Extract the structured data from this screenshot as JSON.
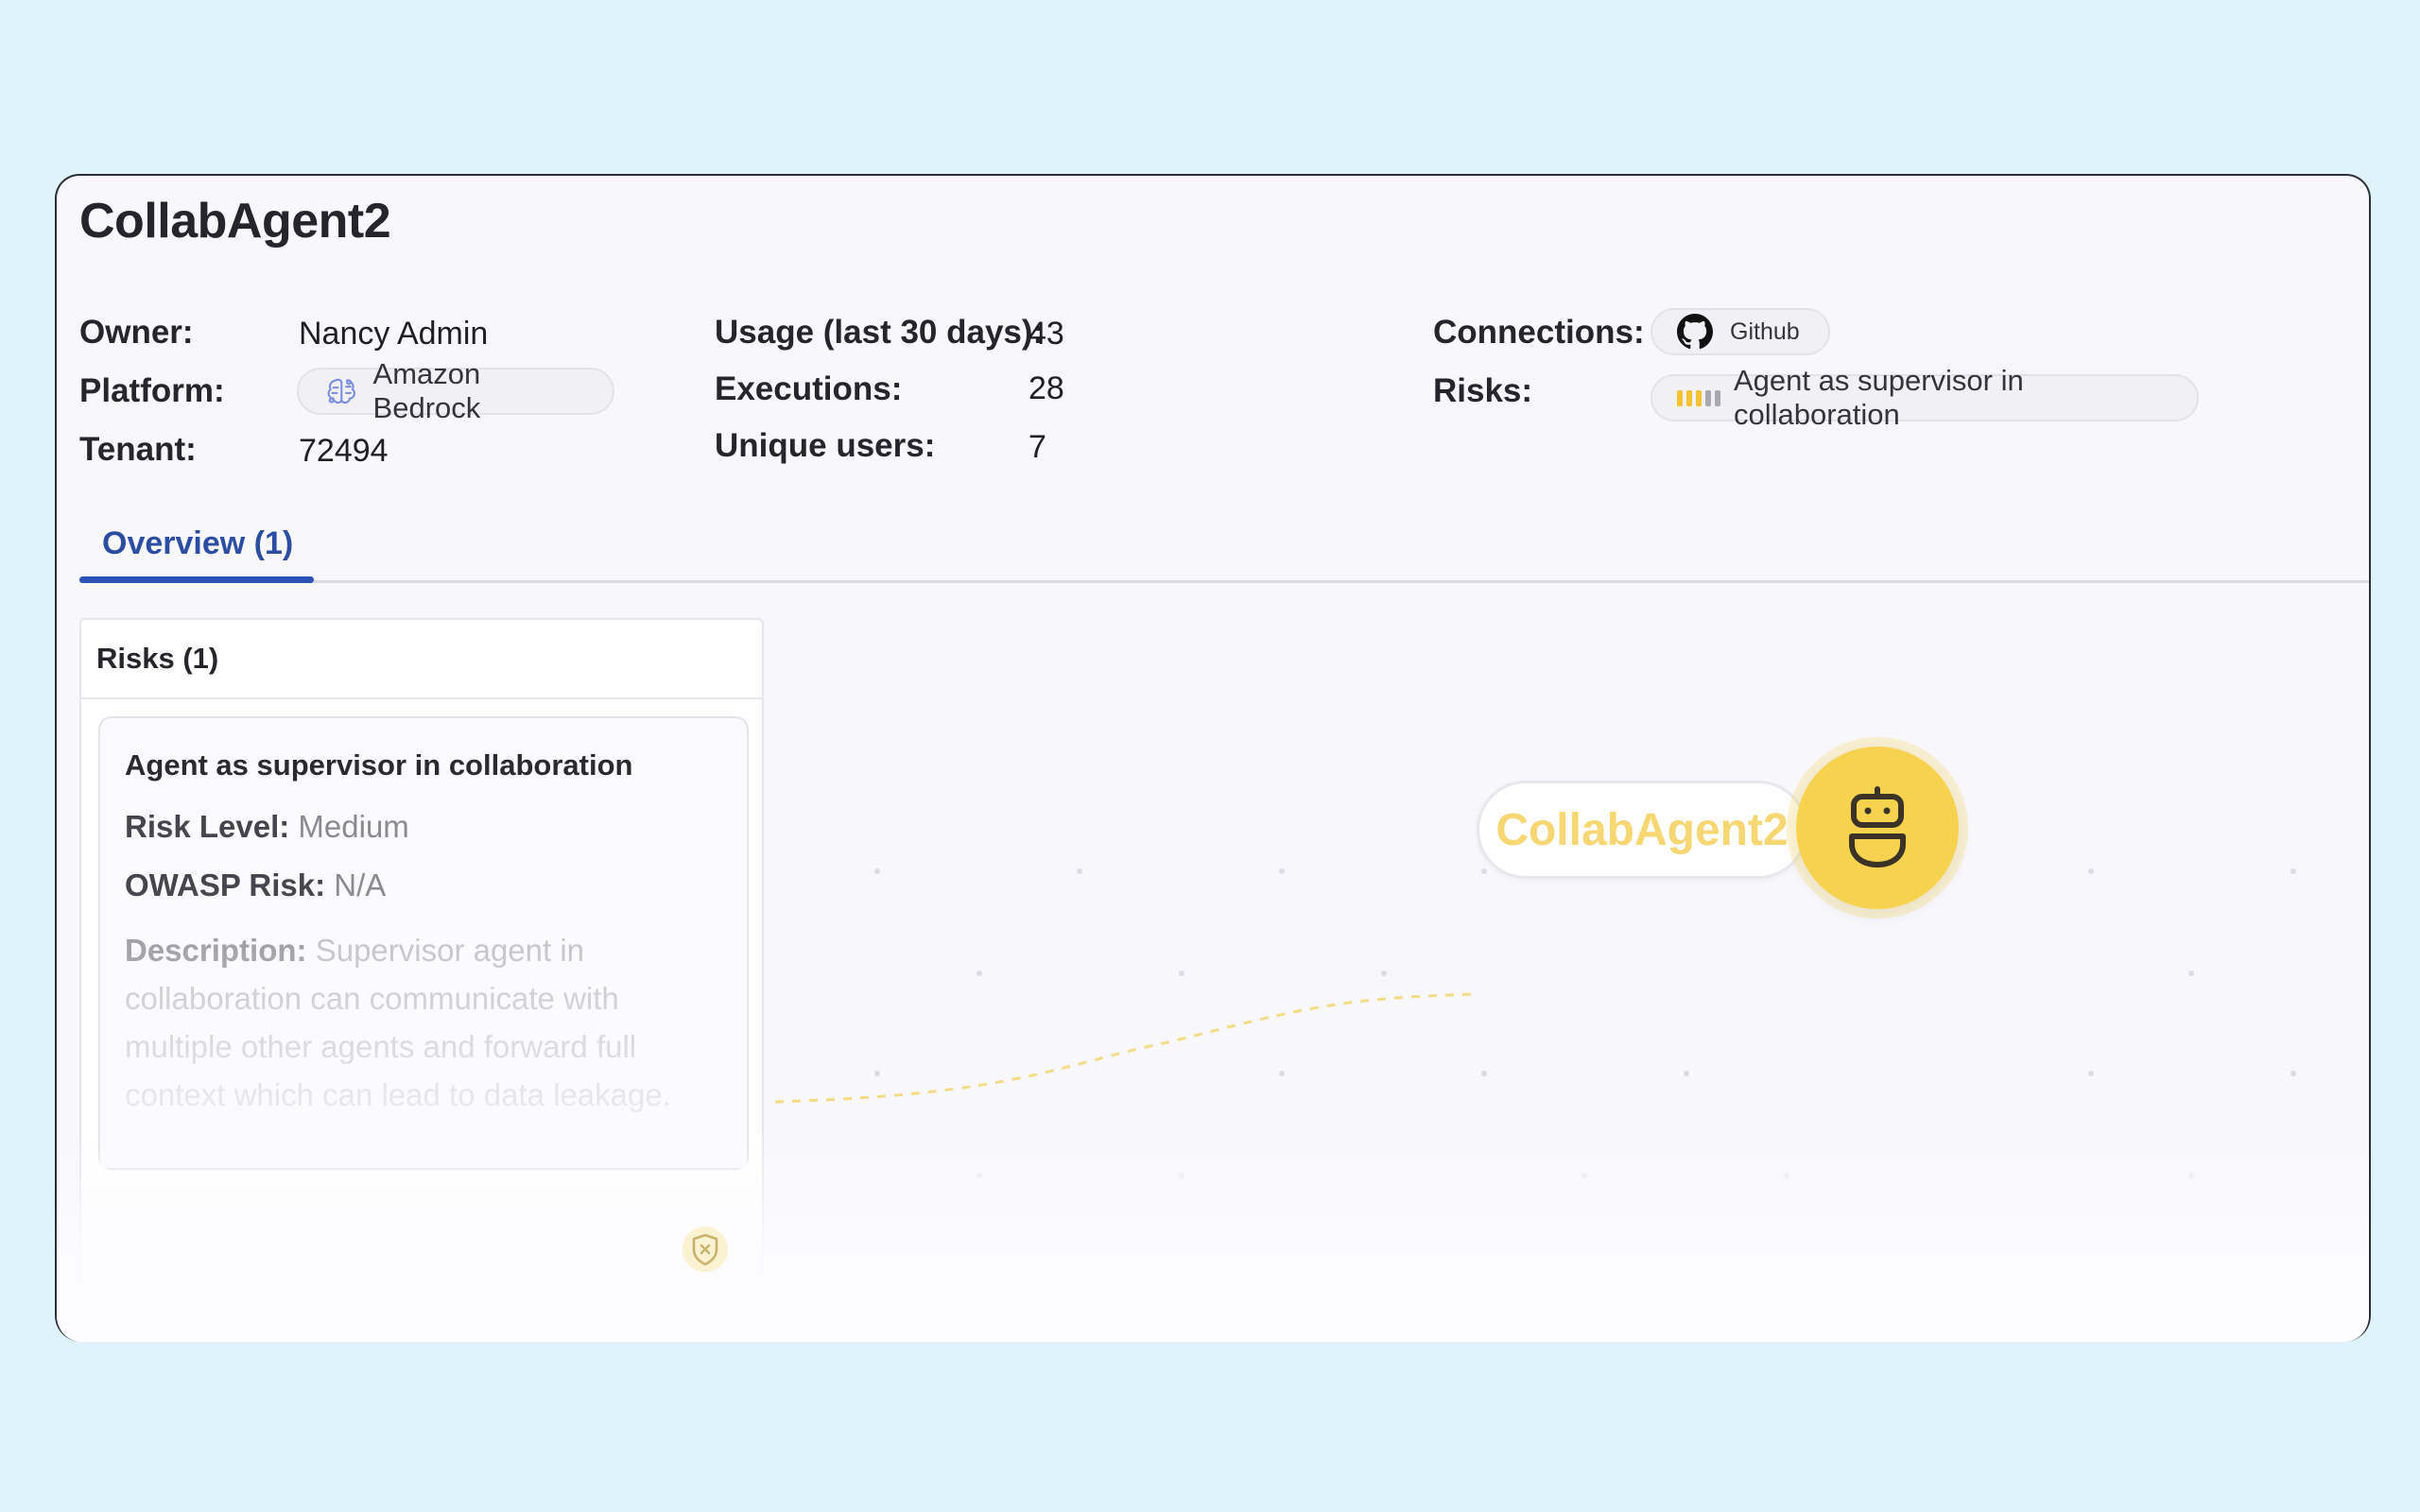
{
  "agent": {
    "name": "CollabAgent2"
  },
  "details": {
    "owner_label": "Owner:",
    "owner_value": "Nancy Admin",
    "platform_label": "Platform:",
    "platform_value": "Amazon Bedrock",
    "tenant_label": "Tenant:",
    "tenant_value": "72494"
  },
  "usage": {
    "usage_label": "Usage (last 30 days):",
    "usage_value": "43",
    "executions_label": "Executions:",
    "executions_value": "28",
    "unique_users_label": "Unique users:",
    "unique_users_value": "7"
  },
  "connections": {
    "label": "Connections:",
    "items": [
      {
        "name": "Github",
        "icon": "github-icon"
      }
    ]
  },
  "risks_summary": {
    "label": "Risks:",
    "items": [
      {
        "name": "Agent as supervisor in collaboration",
        "level_bars_filled": 3,
        "level_bars_total": 5
      }
    ]
  },
  "tabs": [
    {
      "label": "Overview (1)",
      "active": true
    }
  ],
  "risk_panel": {
    "title": "Risks (1)",
    "cards": [
      {
        "title": "Agent as supervisor in collaboration",
        "risk_level_label": "Risk Level:",
        "risk_level_value": "Medium",
        "owasp_label": "OWASP Risk:",
        "owasp_value": "N/A",
        "description_label": "Description:",
        "description_value": "Supervisor agent in collaboration can communicate with multiple other agents and forward full context which can lead to data leakage."
      }
    ]
  },
  "graph": {
    "nodes": [
      {
        "label": "CollabAgent2",
        "icon": "robot-icon"
      }
    ]
  },
  "colors": {
    "page_bg": "#dff3fc",
    "panel_bg": "#f8f7fc",
    "tab_accent": "#2c53b5",
    "node_yellow": "#f7d24e",
    "medium_risk": "#f2c230"
  }
}
